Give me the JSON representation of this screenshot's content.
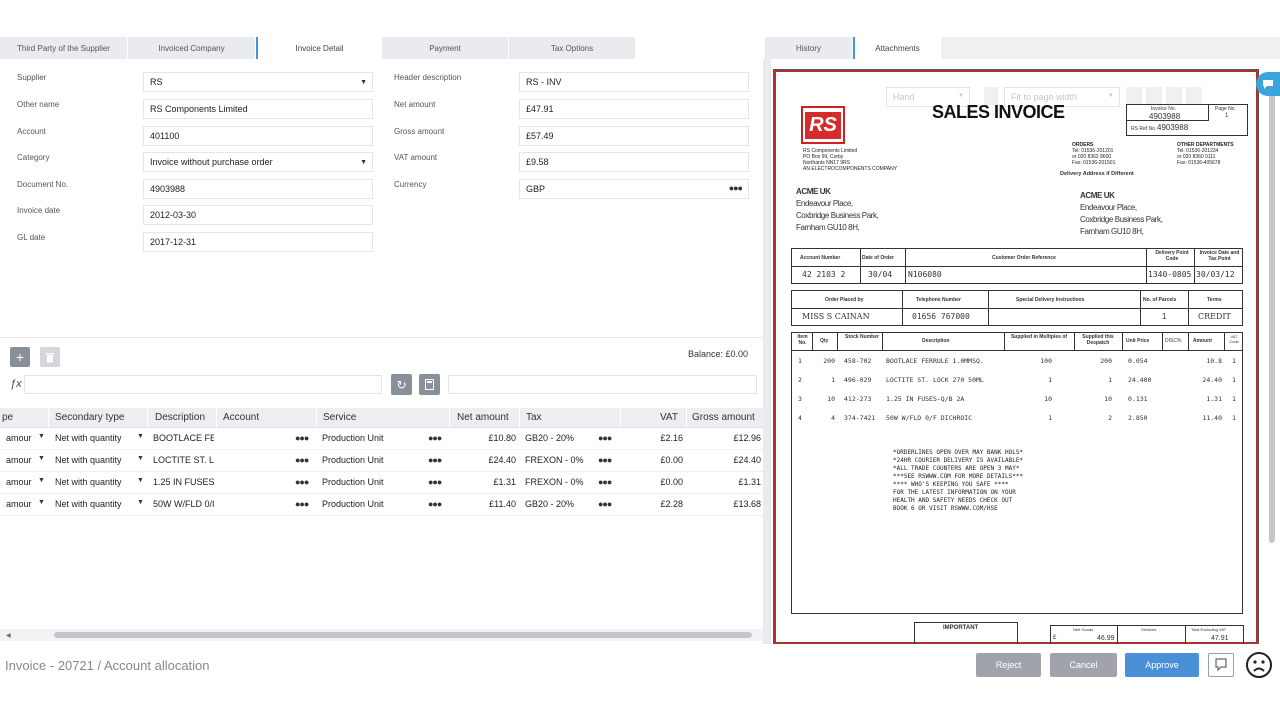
{
  "tabs": [
    "Third Party of the Supplier",
    "Invoiced Company",
    "Invoice Detail",
    "Payment",
    "Tax Options"
  ],
  "right_tabs": [
    "History",
    "Attachments"
  ],
  "form_left": [
    {
      "label": "Supplier",
      "value": "RS",
      "type": "select"
    },
    {
      "label": "Other name",
      "value": "RS Components Limited",
      "type": "text"
    },
    {
      "label": "Account",
      "value": "401100",
      "type": "text"
    },
    {
      "label": "Category",
      "value": "Invoice without purchase order",
      "type": "select"
    },
    {
      "label": "Document No.",
      "value": "4903988",
      "type": "text"
    },
    {
      "label": "Invoice date",
      "value": "2012-03-30",
      "type": "text"
    },
    {
      "label": "GL date",
      "value": "2017-12-31",
      "type": "text"
    }
  ],
  "form_right": [
    {
      "label": "Header description",
      "value": "RS - INV",
      "type": "text"
    },
    {
      "label": "Net amount",
      "value": "£47.91",
      "type": "text"
    },
    {
      "label": "Gross amount",
      "value": "£57.49",
      "type": "text"
    },
    {
      "label": "VAT amount",
      "value": "£9.58",
      "type": "text"
    },
    {
      "label": "Currency",
      "value": "GBP",
      "type": "lookup"
    }
  ],
  "balance": "Balance: £0.00",
  "fx_label": "ƒx",
  "grid": {
    "columns": [
      "pe",
      "Secondary type",
      "Description",
      "Account",
      "Service",
      "Net amount",
      "Tax",
      "VAT",
      "Gross amount"
    ],
    "rows": [
      [
        "amour",
        "Net with quantity",
        "BOOTLACE FEI",
        "",
        "Production Unit",
        "£10.80",
        "GB20 - 20%",
        "£2.16",
        "£12.96"
      ],
      [
        "amour",
        "Net with quantity",
        "LOCTITE ST. LC",
        "",
        "Production Unit",
        "£24.40",
        "FREXON - 0%",
        "£0.00",
        "£24.40"
      ],
      [
        "amour",
        "Net with quantity",
        "1.25 IN FUSES",
        "",
        "Production Unit",
        "£1.31",
        "FREXON - 0%",
        "£0.00",
        "£1.31"
      ],
      [
        "amour",
        "Net with quantity",
        "50W W/FLD 0/I",
        "",
        "Production Unit",
        "£11.40",
        "GB20 - 20%",
        "£2.28",
        "£13.68"
      ]
    ]
  },
  "breadcrumb": "Invoice  - 20721  / Account allocation",
  "buttons": {
    "reject": "Reject",
    "cancel": "Cancel",
    "approve": "Approve"
  },
  "viewer_toolbar": {
    "mode": "Hand",
    "zoom": "Fit to page width"
  },
  "doc": {
    "title": "SALES INVOICE",
    "logo": "RS",
    "company_lines": [
      "RS Components Limited",
      "PO Box 99, Corby",
      "Northants NN17 9RS",
      "AN ELECTROCOMPONENTS COMPANY"
    ],
    "orders_head": "ORDERS",
    "orders_lines": [
      "Tel: 01536-201201",
      "or 020 8362 8600",
      "Fax: 01536-201501"
    ],
    "other_head": "OTHER DEPARTMENTS",
    "other_lines": [
      "Tel: 01536-201234",
      "or 020 8360 0111",
      "Fax: 01536-405678"
    ],
    "delivery_note": "Delivery Address if Different",
    "invoice_no_label": "Invoice No.",
    "invoice_no": "4903988",
    "page_no_label": "Page No.",
    "page_no": "1",
    "ref_label": "RS Ref No.",
    "ref": "4903988",
    "bill_to": [
      "ACME UK",
      "Endeavour Place,",
      "Coxbridge Business Park,",
      "Farnham GU10 8H,"
    ],
    "ship_to": [
      "ACME UK",
      "Endeavour Place,",
      "Coxbridge Business Park,",
      "Farnham GU10 8H,"
    ],
    "t1_heads": [
      "Account Number",
      "Date of Order",
      "Customer Order Reference",
      "Delivery Point Code",
      "Invoice Date and Tax Point"
    ],
    "t1_vals": [
      "42 2103 2",
      "30/04",
      "N106080",
      "1340-0805",
      "30/03/12"
    ],
    "t2_heads": [
      "Order Placed by",
      "Telephone Number",
      "Special Delivery Instructions",
      "No. of Parcels",
      "Terms"
    ],
    "t2_vals": [
      "MISS S CAINAN",
      "01656 767000",
      "",
      "1",
      "CREDIT"
    ],
    "t3_heads": [
      "Item No.",
      "Qty",
      "Stock Number",
      "Description",
      "Supplied in Multiples of",
      "Supplied this Despatch",
      "Unit Price",
      "DISC%",
      "Amount",
      "VAT Code"
    ],
    "items": [
      [
        "1",
        "200",
        "458-702",
        "BOOTLACE FERRULE 1.0MMSQ.",
        "100",
        "200",
        "0.054",
        "",
        "10.8",
        "1"
      ],
      [
        "2",
        "1",
        "496-029",
        "LOCTITE ST. LOCK 270 50ML",
        "1",
        "1",
        "24.400",
        "",
        "24.40",
        "1"
      ],
      [
        "3",
        "10",
        "412-273",
        "1.25 IN FUSES-Q/B 2A",
        "10",
        "10",
        "0.131",
        "",
        "1.31",
        "1"
      ],
      [
        "4",
        "4",
        "374-7421",
        "50W W/FLD 0/F DICHROIC",
        "1",
        "2",
        "2.850",
        "",
        "11.40",
        "1"
      ]
    ],
    "notes": [
      "*ORDERLINES OPEN OVER MAY BANK HOLS*",
      "*24HR COURIER DELIVERY IS AVAILABLE*",
      "*ALL TRADE COUNTERS ARE OPEN 3 MAY*",
      "***SEE RSWWW.COM FOR MORE DETAILS***",
      "**** WHO'S KEEPING YOU SAFE ****",
      "FOR THE LATEST INFORMATION ON YOUR",
      "HEALTH AND SAFETY NEEDS CHECK OUT",
      "BOOK 6 OR VISIT RSWWW.COM/HSE"
    ],
    "important": "IMPORTANT",
    "totals_heads": [
      "Nett Goods",
      "Services",
      "Total Excluding VAT"
    ],
    "totals_vals": [
      "46.99",
      "",
      "47.91"
    ],
    "currency_mark": "£"
  },
  "colors": {
    "accent": "#4a90d9",
    "approve": "#4a90d9",
    "reject": "#a0a4aa",
    "doc_border": "#b13030"
  }
}
